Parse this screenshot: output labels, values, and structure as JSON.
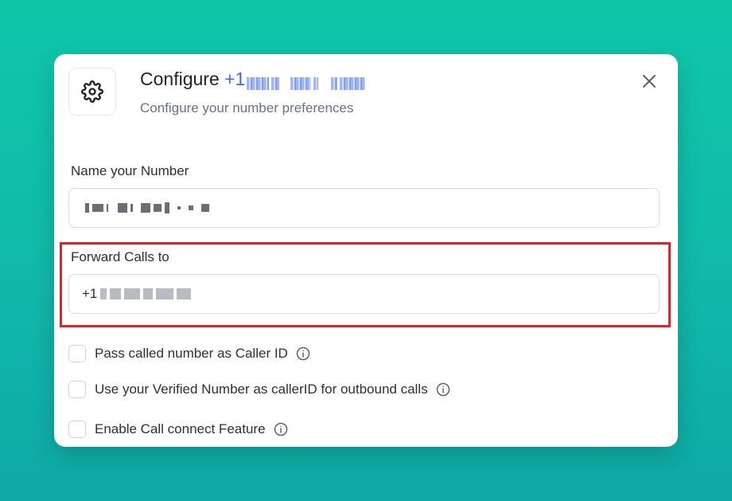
{
  "modal": {
    "title_prefix": "Configure",
    "title_number": "+1",
    "subtitle": "Configure your number preferences",
    "icons": {
      "settings": "gear-icon",
      "close": "close-icon",
      "info": "info-icon"
    }
  },
  "name_field": {
    "label": "Name your Number"
  },
  "forward_field": {
    "label": "Forward Calls to",
    "prefix": "+1"
  },
  "options": [
    {
      "label": "Pass called number as Caller ID",
      "checked": false
    },
    {
      "label": "Use your Verified Number as callerID for outbound calls",
      "checked": false
    },
    {
      "label": "Enable Call connect Feature",
      "checked": false
    }
  ],
  "colors": {
    "accent": "#3f6ae8",
    "highlight": "#d8262a",
    "background": "#11b9aa"
  }
}
